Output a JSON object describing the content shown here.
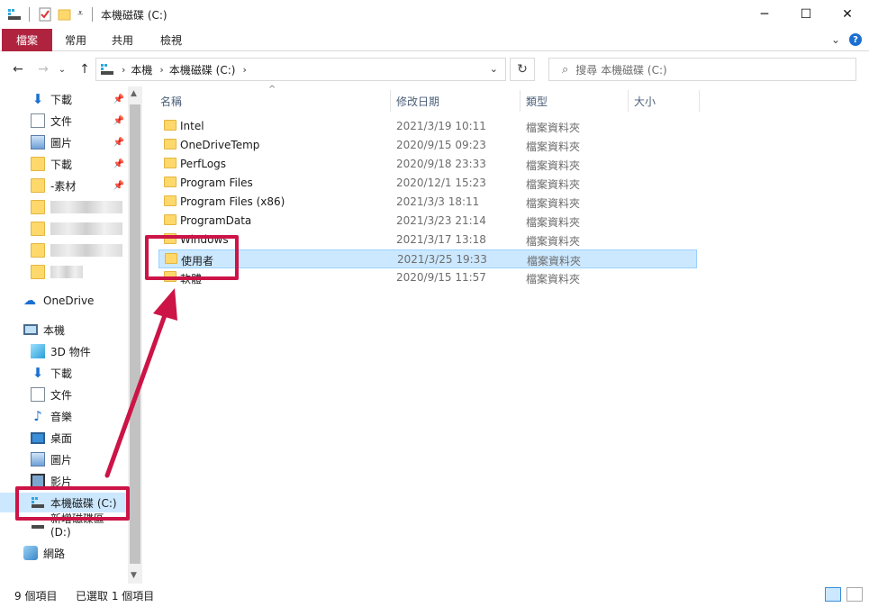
{
  "window": {
    "title": "本機磁碟 (C:)",
    "minimize_glyph": "─",
    "maximize_glyph": "☐",
    "close_glyph": "✕"
  },
  "ribbon": {
    "tabs": [
      "檔案",
      "常用",
      "共用",
      "檢視"
    ],
    "expand_glyph": "⌄",
    "help_label": "?"
  },
  "nav": {
    "back_glyph": "←",
    "forward_glyph": "→",
    "recent_glyph": "⌄",
    "up_glyph": "↑",
    "breadcrumb": [
      "本機",
      "本機磁碟 (C:)"
    ],
    "refresh_glyph": "↻",
    "search_placeholder": "搜尋 本機磁碟 (C:)"
  },
  "sidebar": {
    "quick_access": [
      {
        "label": "下載",
        "icon": "download-icon",
        "pinned": true
      },
      {
        "label": "文件",
        "icon": "document-icon",
        "pinned": true
      },
      {
        "label": "圖片",
        "icon": "picture-icon",
        "pinned": true
      },
      {
        "label": "下載",
        "icon": "folder-icon",
        "pinned": true
      },
      {
        "label": "-素材",
        "icon": "folder-icon",
        "pinned": true
      }
    ],
    "pin_glyph": "📌",
    "onedrive": "OneDrive",
    "this_pc": "本機",
    "pc_items": [
      "3D 物件",
      "下載",
      "文件",
      "音樂",
      "桌面",
      "圖片",
      "影片"
    ],
    "drives": [
      "本機磁碟 (C:)",
      "新增磁碟區 (D:)"
    ],
    "network": "網路"
  },
  "columns": {
    "sort_glyph": "^",
    "name": "名稱",
    "date": "修改日期",
    "type": "類型",
    "size": "大小"
  },
  "files": [
    {
      "name": "Intel",
      "date": "2021/3/19 10:11",
      "type": "檔案資料夾"
    },
    {
      "name": "OneDriveTemp",
      "date": "2020/9/15 09:23",
      "type": "檔案資料夾"
    },
    {
      "name": "PerfLogs",
      "date": "2020/9/18 23:33",
      "type": "檔案資料夾"
    },
    {
      "name": "Program Files",
      "date": "2020/12/1 15:23",
      "type": "檔案資料夾"
    },
    {
      "name": "Program Files (x86)",
      "date": "2021/3/3 18:11",
      "type": "檔案資料夾"
    },
    {
      "name": "ProgramData",
      "date": "2021/3/23 21:14",
      "type": "檔案資料夾"
    },
    {
      "name": "Windows",
      "date": "2021/3/17 13:18",
      "type": "檔案資料夾"
    },
    {
      "name": "使用者",
      "date": "2021/3/25 19:33",
      "type": "檔案資料夾"
    },
    {
      "name": "軟體",
      "date": "2020/9/15 11:57",
      "type": "檔案資料夾"
    }
  ],
  "status": {
    "item_count": "9 個項目",
    "selected": "已選取 1 個項目"
  },
  "colors": {
    "file_tab": "#b0233f",
    "selection": "#cce8ff",
    "annotation": "#cc1446",
    "folder": "#ffd86b"
  }
}
